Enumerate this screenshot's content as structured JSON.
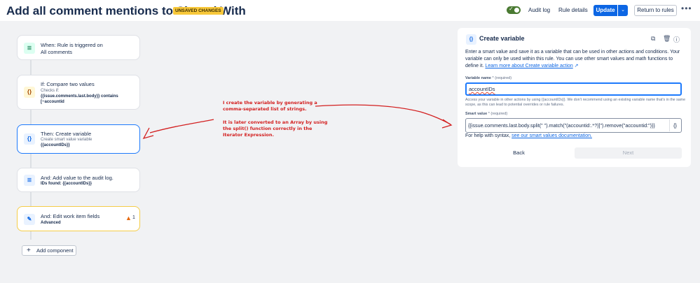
{
  "header": {
    "title": "Add all comment mentions to Shared With",
    "badge": "UNSAVED CHANGES",
    "toggle_on": true,
    "audit_log": "Audit log",
    "rule_details": "Rule details",
    "update": "Update",
    "return": "Return to rules",
    "more": "•••"
  },
  "flow": {
    "cards": [
      {
        "icon": "comment-icon",
        "glyph": "≣",
        "line1": "When: Rule is triggered on",
        "line2": "All comments"
      },
      {
        "icon": "condition-icon",
        "glyph": "{}",
        "line1": "If: Compare two values",
        "sub": "Checks if:",
        "bold1": "{{issue.comments.last.body}} contains",
        "bold2": "[~accountid"
      },
      {
        "icon": "variable-icon",
        "glyph": "{}",
        "line1": "Then: Create variable",
        "sub": "Create smart value variable",
        "bold1": "{{accountIDs}}"
      },
      {
        "icon": "audit-log-icon",
        "glyph": "≣",
        "line1": "And: Add value to the audit log.",
        "bold1": "IDs found: {{accountIDs}}"
      },
      {
        "icon": "edit-icon",
        "glyph": "✎",
        "line1": "And: Edit work item fields",
        "bold1": "Advanced",
        "warning_count": "1"
      }
    ],
    "add_component": "Add component"
  },
  "annotation": {
    "line1": "I create the variable by generating a",
    "line2": "comma-separated list of strings.",
    "line3": "It is later converted to an Array by using",
    "line4": "the split() function correctly in the",
    "line5": "Iterator Expression.",
    "color": "#d32020"
  },
  "panel": {
    "title": "Create variable",
    "desc": "Enter a smart value and save it as a variable that can be used in other actions and conditions. Your variable can only be used within this rule. You can use other smart values and math functions to define it.",
    "desc_link": "Learn more about Create variable action",
    "name_label": "Variable name",
    "name_required": "* (required)",
    "name_value": "accountIDs",
    "name_help": "Access your variable in other actions by using {{accountIDs}}. We don't recommend using an existing variable name that's in the same scope, as this can lead to potential overrides or rule failures.",
    "smart_label": "Smart value",
    "smart_required": "* (required)",
    "smart_value": "{{issue.comments.last.body.split(\" \").match(\"(accountid:.*?)]\").remove(\"accountid:\")}}",
    "brace_button": "{}",
    "syntax_help": "For help with syntax,",
    "syntax_link": "see our smart values documentation.",
    "back": "Back",
    "next": "Next"
  },
  "colors": {
    "primary": "#0c66e4",
    "badge": "#f8c83a",
    "selected_border": "#1d7afc",
    "warning": "#e56910"
  }
}
